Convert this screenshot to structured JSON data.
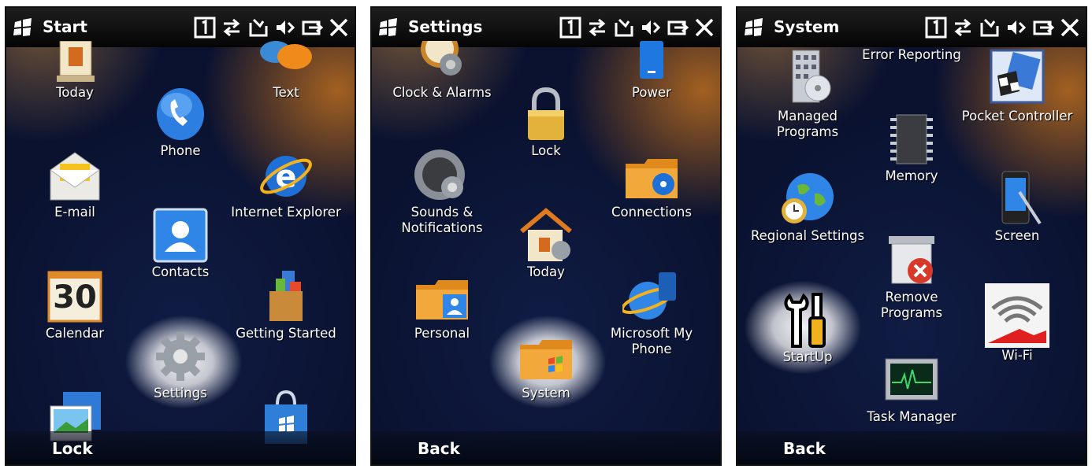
{
  "status_icons": [
    "sim-card-1-icon",
    "data-sync-icon",
    "phone-missed-icon",
    "volume-muted-icon",
    "battery-plug-icon",
    "close-icon"
  ],
  "start_screen": {
    "title": "Start",
    "softkey": "Lock",
    "items": [
      {
        "label": "Today"
      },
      {
        "label": "Text"
      },
      {
        "label": "Phone"
      },
      {
        "label": "E-mail"
      },
      {
        "label": "Internet Explorer"
      },
      {
        "label": "Contacts"
      },
      {
        "label": "Calendar"
      },
      {
        "label": "Getting Started"
      },
      {
        "label": "Settings",
        "selected": true
      },
      {
        "label": "Pictures"
      },
      {
        "label": "Marketplace"
      }
    ],
    "calendar_day": "30"
  },
  "settings_screen": {
    "title": "Settings",
    "softkey": "Back",
    "items": [
      {
        "label": "Clock & Alarms"
      },
      {
        "label": "Power"
      },
      {
        "label": "Lock"
      },
      {
        "label": "Sounds &\nNotifications"
      },
      {
        "label": "Connections"
      },
      {
        "label": "Today"
      },
      {
        "label": "Personal"
      },
      {
        "label": "Microsoft My\nPhone"
      },
      {
        "label": "System",
        "selected": true
      }
    ]
  },
  "system_screen": {
    "title": "System",
    "softkey": "Back",
    "items": [
      {
        "label": "Error Reporting"
      },
      {
        "label": "Managed\nPrograms"
      },
      {
        "label": "Pocket Controller"
      },
      {
        "label": "Memory"
      },
      {
        "label": "Regional Settings"
      },
      {
        "label": "Screen"
      },
      {
        "label": "Remove Programs"
      },
      {
        "label": "StartUp",
        "selected": true
      },
      {
        "label": "Wi-Fi"
      },
      {
        "label": "Task Manager"
      }
    ]
  }
}
